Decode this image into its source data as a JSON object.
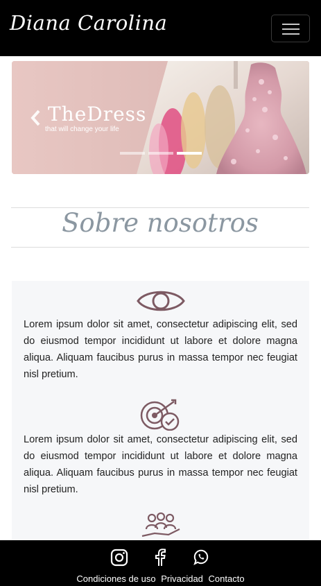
{
  "navbar": {
    "brand": "Diana Carolina",
    "menu_icon": "hamburger-icon"
  },
  "carousel": {
    "title": "TheDress",
    "subtitle": "that will change your life",
    "prev_icon": "chevron-left-icon",
    "slide_count": 3,
    "active_slide": 3
  },
  "about": {
    "title": "Sobre nosotros",
    "items": [
      {
        "icon": "eye-icon",
        "text": "Lorem ipsum dolor sit amet, consectetur adipiscing elit, sed do eiusmod tempor incididunt ut labore et dolore magna aliqua. Aliquam faucibus purus in massa tempor nec feugiat nisl pretium."
      },
      {
        "icon": "target-check-icon",
        "text": "Lorem ipsum dolor sit amet, consectetur adipiscing elit, sed do eiusmod tempor incididunt ut labore et dolore magna aliqua. Aliquam faucibus purus in massa tempor nec feugiat nisl pretium."
      },
      {
        "icon": "team-hand-icon",
        "text": ""
      }
    ],
    "icon_color": "#7d5a63"
  },
  "footer": {
    "social": [
      "instagram-icon",
      "facebook-icon",
      "whatsapp-icon"
    ],
    "links": [
      "Condiciones de uso",
      "Privacidad",
      "Contacto"
    ]
  }
}
